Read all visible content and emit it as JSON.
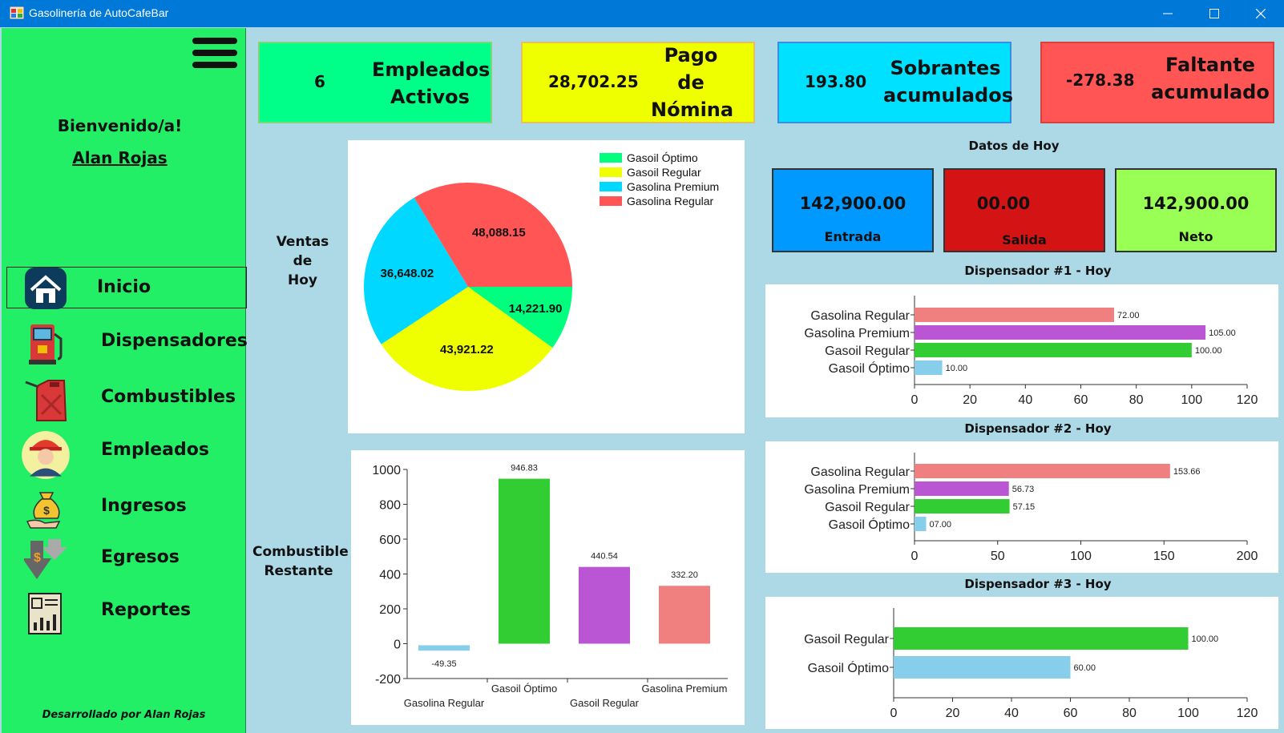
{
  "window": {
    "title": "Gasolinería de AutoCafeBar"
  },
  "sidebar": {
    "welcome": "Bienvenido/a!",
    "user": "Alan Rojas",
    "items": [
      {
        "label": "Inicio",
        "icon": "home-icon"
      },
      {
        "label": "Dispensadores",
        "icon": "fuel-pump-icon"
      },
      {
        "label": "Combustibles",
        "icon": "jerrycan-icon"
      },
      {
        "label": "Empleados",
        "icon": "worker-icon"
      },
      {
        "label": "Ingresos",
        "icon": "money-bag-icon"
      },
      {
        "label": "Egresos",
        "icon": "expense-icon"
      },
      {
        "label": "Reportes",
        "icon": "report-icon"
      }
    ],
    "footer": "Desarrollado por Alan Rojas"
  },
  "cards": [
    {
      "value": "6",
      "label": "Empleados Activos",
      "color": "#00ff88"
    },
    {
      "value": "28,702.25",
      "label": "Pago de Nómina",
      "color": "#f0ff00"
    },
    {
      "value": "193.80",
      "label": "Sobrantes acumulados",
      "color": "#00e0ff"
    },
    {
      "value": "-278.38",
      "label": "Faltante acumulado",
      "color": "#ff5555"
    }
  ],
  "labels": {
    "ventas": "Ventas de Hoy",
    "combustible": "Combustible Restante",
    "datos_hoy": "Datos de Hoy"
  },
  "today": {
    "entrada": {
      "value": "142,900.00",
      "label": "Entrada"
    },
    "salida": {
      "value": "00.00",
      "label": "Salida"
    },
    "neto": {
      "value": "142,900.00",
      "label": "Neto"
    }
  },
  "chart_data": [
    {
      "type": "pie",
      "title": "",
      "categories": [
        "Gasoil Óptimo",
        "Gasoil Regular",
        "Gasolina Premium",
        "Gasolina Regular"
      ],
      "values": [
        14221.9,
        43921.22,
        36648.02,
        48088.15
      ],
      "value_labels": [
        "14,221.90",
        "43,921.22",
        "36,648.02",
        "48,088.15"
      ],
      "colors": [
        "#00ff7f",
        "#f0ff00",
        "#00d8ff",
        "#ff5555"
      ],
      "legend": "top-right"
    },
    {
      "type": "bar",
      "title": "",
      "categories": [
        "Gasolina Regular",
        "Gasoil Óptimo",
        "Gasoil Regular",
        "Gasolina Premium"
      ],
      "values": [
        -49.35,
        946.83,
        440.54,
        332.2
      ],
      "value_labels": [
        "-49.35",
        "946.83",
        "440.54",
        "332.20"
      ],
      "colors": [
        "#87ceeb",
        "#32cd32",
        "#ba55d3",
        "#f08080"
      ],
      "ylim": [
        -200,
        1000
      ],
      "yticks": [
        -200,
        0,
        200,
        400,
        600,
        800,
        1000
      ]
    },
    {
      "type": "bar",
      "orientation": "horizontal",
      "title": "Dispensador #1 - Hoy",
      "categories": [
        "Gasolina Regular",
        "Gasolina Premium",
        "Gasoil Regular",
        "Gasoil Óptimo"
      ],
      "values": [
        72.0,
        105.0,
        100.0,
        10.0
      ],
      "value_labels": [
        "72.00",
        "105.00",
        "100.00",
        "10.00"
      ],
      "colors": [
        "#f08080",
        "#ba55d3",
        "#32cd32",
        "#87ceeb"
      ],
      "xlim": [
        0,
        120
      ],
      "xticks": [
        0,
        20,
        40,
        60,
        80,
        100,
        120
      ]
    },
    {
      "type": "bar",
      "orientation": "horizontal",
      "title": "Dispensador #2 - Hoy",
      "categories": [
        "Gasolina Regular",
        "Gasolina Premium",
        "Gasoil Regular",
        "Gasoil Óptimo"
      ],
      "values": [
        153.66,
        56.73,
        57.15,
        7.0
      ],
      "value_labels": [
        "153.66",
        "56.73",
        "57.15",
        "07.00"
      ],
      "colors": [
        "#f08080",
        "#ba55d3",
        "#32cd32",
        "#87ceeb"
      ],
      "xlim": [
        0,
        200
      ],
      "xticks": [
        0,
        50,
        100,
        150,
        200
      ]
    },
    {
      "type": "bar",
      "orientation": "horizontal",
      "title": "Dispensador #3 - Hoy",
      "categories": [
        "Gasoil Regular",
        "Gasoil Óptimo"
      ],
      "values": [
        100.0,
        60.0
      ],
      "value_labels": [
        "100.00",
        "60.00"
      ],
      "colors": [
        "#32cd32",
        "#87ceeb"
      ],
      "xlim": [
        0,
        120
      ],
      "xticks": [
        0,
        20,
        40,
        60,
        80,
        100,
        120
      ]
    }
  ]
}
